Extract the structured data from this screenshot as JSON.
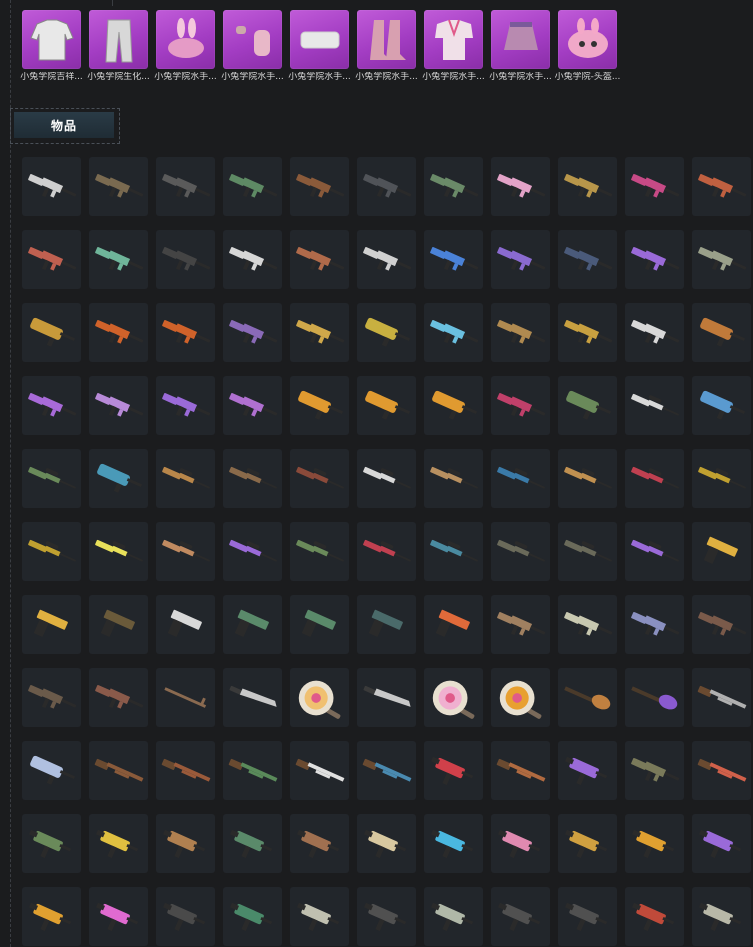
{
  "outfits": [
    {
      "label": "小兔学院吉祥...",
      "icon": "hoodie-icon"
    },
    {
      "label": "小兔学院生化...",
      "icon": "pants-icon"
    },
    {
      "label": "小兔学院水手...",
      "icon": "bunny-hat-icon"
    },
    {
      "label": "小兔学院水手...",
      "icon": "gloves-icon"
    },
    {
      "label": "小兔学院水手...",
      "icon": "mask-icon"
    },
    {
      "label": "小兔学院水手...",
      "icon": "boots-icon"
    },
    {
      "label": "小兔学院水手...",
      "icon": "sailor-top-icon"
    },
    {
      "label": "小兔学院水手...",
      "icon": "skirt-icon"
    },
    {
      "label": "小兔学院-头盔...",
      "icon": "bunny-helmet-icon"
    }
  ],
  "section": {
    "title": "物品"
  },
  "items": [
    "rifle:#cfcfcf",
    "rifle:#7a6a50",
    "rifle:#5a5a5a",
    "rifle:#5e8a64",
    "rifle:#8a5a3a",
    "rifle:#505358",
    "rifle:#6a8a68",
    "rifle:#e3a3c8",
    "rifle:#b8964a",
    "rifle:#c74a86",
    "rifle:#c06040",
    "rifle:#c06050",
    "rifle:#6fb59a",
    "rifle:#444",
    "rifle:#d6d6d6",
    "rifle:#b06a4a",
    "rifle:#d0d0d0",
    "rifle:#4a82d8",
    "rifle:#8a6ad0",
    "rifle:#4a5a7a",
    "rifle:#9a6ad8",
    "rifle:#9aa08a",
    "bullpup:#c89a3a",
    "rifle:#d0622a",
    "rifle:#d0622a",
    "rifle:#8a6ab8",
    "rifle:#d0a84a",
    "bullpup:#c8b040",
    "rifle:#6ac0e0",
    "rifle:#b08a50",
    "rifle:#c8a040",
    "rifle:#d8d8d8",
    "bullpup:#c07a3a",
    "rifle:#a86ad8",
    "rifle:#b88ad8",
    "rifle:#9a6ad8",
    "rifle:#b070d0",
    "bullpup:#e09a30",
    "bullpup:#e09a30",
    "bullpup:#e09a30",
    "rifle:#c0406a",
    "bullpup:#6a8a5a",
    "sniper:#d8d8d8",
    "bullpup:#5a9ad0",
    "sniper:#6a8a5a",
    "bullpup:#4a9ab8",
    "sniper:#b8864a",
    "sniper:#8a6a4a",
    "sniper:#8a4a3a",
    "sniper:#d8d8d8",
    "sniper:#b89060",
    "sniper:#3a7aa8",
    "sniper:#c09050",
    "sniper:#c04050",
    "sniper:#c0a030",
    "sniper:#c0a030",
    "sniper:#e8e05a",
    "sniper:#c08a60",
    "sniper:#9a6ad8",
    "sniper:#6a8a5a",
    "sniper:#c04050",
    "sniper:#4a8aa0",
    "sniper:#6a6a5a",
    "sniper:#6a6a5a",
    "sniper:#9a6ad8",
    "pistol:#e0b040",
    "pistol:#e0b040",
    "pistol:#6a5a3a",
    "pistol:#d8d8d8",
    "pistol:#5a8a6a",
    "pistol:#5a8a6a",
    "pistol:#4a6a6a",
    "pistol:#e06a3a",
    "rifle:#a08060",
    "rifle:#c8c8b0",
    "rifle:#8a90c0",
    "rifle:#7a5a4a",
    "rifle:#6a5a4a",
    "rifle:#8a5a4a",
    "crowbar:#8a6a50",
    "machete:#c8c8c8",
    "pan:#f0c070",
    "machete:#c8c8c8",
    "pan:#f0b0d0",
    "pan:#e8a030",
    "sickle:#c08040",
    "sickle:#8a5ad0",
    "shotgun:#b0b0b0",
    "bullpup:#b0c0e0",
    "shotgun:#8a5a3a",
    "shotgun:#9a5a3a",
    "shotgun:#5a8a5a",
    "shotgun:#e0e0e0",
    "shotgun:#4a8ab0",
    "smg:#d0404a",
    "shotgun:#b06a40",
    "smg:#9a6ad8",
    "rifle:#7a7a5a",
    "shotgun:#d0604a",
    "smg:#6a8a5a",
    "smg:#e0c040",
    "smg:#b08050",
    "smg:#5a8a6a",
    "smg:#a07050",
    "smg:#d8c8a0",
    "smg:#4ab8e0",
    "smg:#e08ab0",
    "smg:#d0a040",
    "smg:#e0a030",
    "smg:#9a6ad8",
    "smg:#e0a030",
    "smg:#e06ad0",
    "smg:#4a4a4a",
    "smg:#4a8a6a",
    "smg:#c0c0b0",
    "smg:#505050",
    "smg:#b0b8a8",
    "smg:#505050",
    "smg:#505050",
    "smg:#c04a3a",
    "smg:#b8b8a8"
  ]
}
